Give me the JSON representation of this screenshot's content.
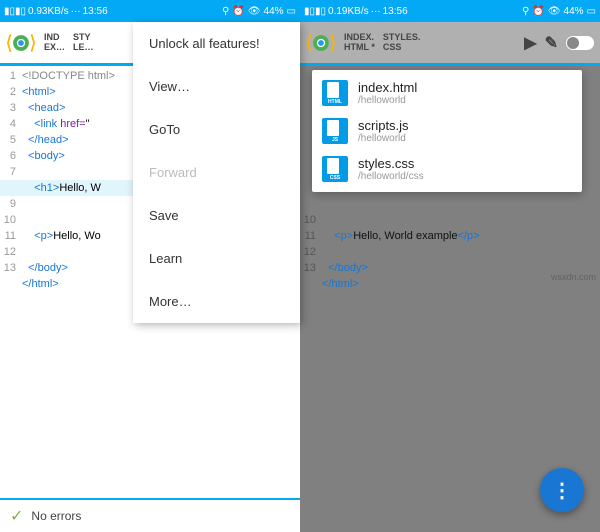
{
  "status_left": {
    "signal_text": "0.93KB/s",
    "time": "13:56",
    "signal_text_r": "0.19KB/s"
  },
  "status_right": {
    "battery": "44%"
  },
  "tabs_left": {
    "t1a": "IND",
    "t1b": "EX…",
    "t2a": "STY",
    "t2b": "LE…"
  },
  "tabs_right": {
    "t1a": "INDEX.",
    "t1b": "HTML *",
    "t2a": "STYLES.",
    "t2b": "CSS"
  },
  "menu": {
    "unlock": "Unlock all features!",
    "view": "View…",
    "goto": "GoTo",
    "forward": "Forward",
    "save": "Save",
    "learn": "Learn",
    "more": "More…"
  },
  "files": [
    {
      "icon": "HTML",
      "name": "index.html",
      "path": "/helloworld"
    },
    {
      "icon": "JS",
      "name": "scripts.js",
      "path": "/helloworld"
    },
    {
      "icon": "CSS",
      "name": "styles.css",
      "path": "/helloworld/css"
    }
  ],
  "code_left": {
    "l1": "<!DOCTYPE html>",
    "l2": "<html>",
    "l3": "  <head>",
    "l4": "    <link href=\"",
    "l5": "  </head>",
    "l6": "  <body>",
    "l7": "",
    "l8": "    <h1>Hello, W",
    "l9": "",
    "l10": "    <p>Hello, Wo",
    "l11": "",
    "l12": "  </body>",
    "l13": "</html>"
  },
  "code_right": {
    "l10": "    <p>Hello, World example</p>",
    "l12": "  </body>",
    "l13": "</html>"
  },
  "status_text": "No errors",
  "watermark": "wsxdn.com"
}
